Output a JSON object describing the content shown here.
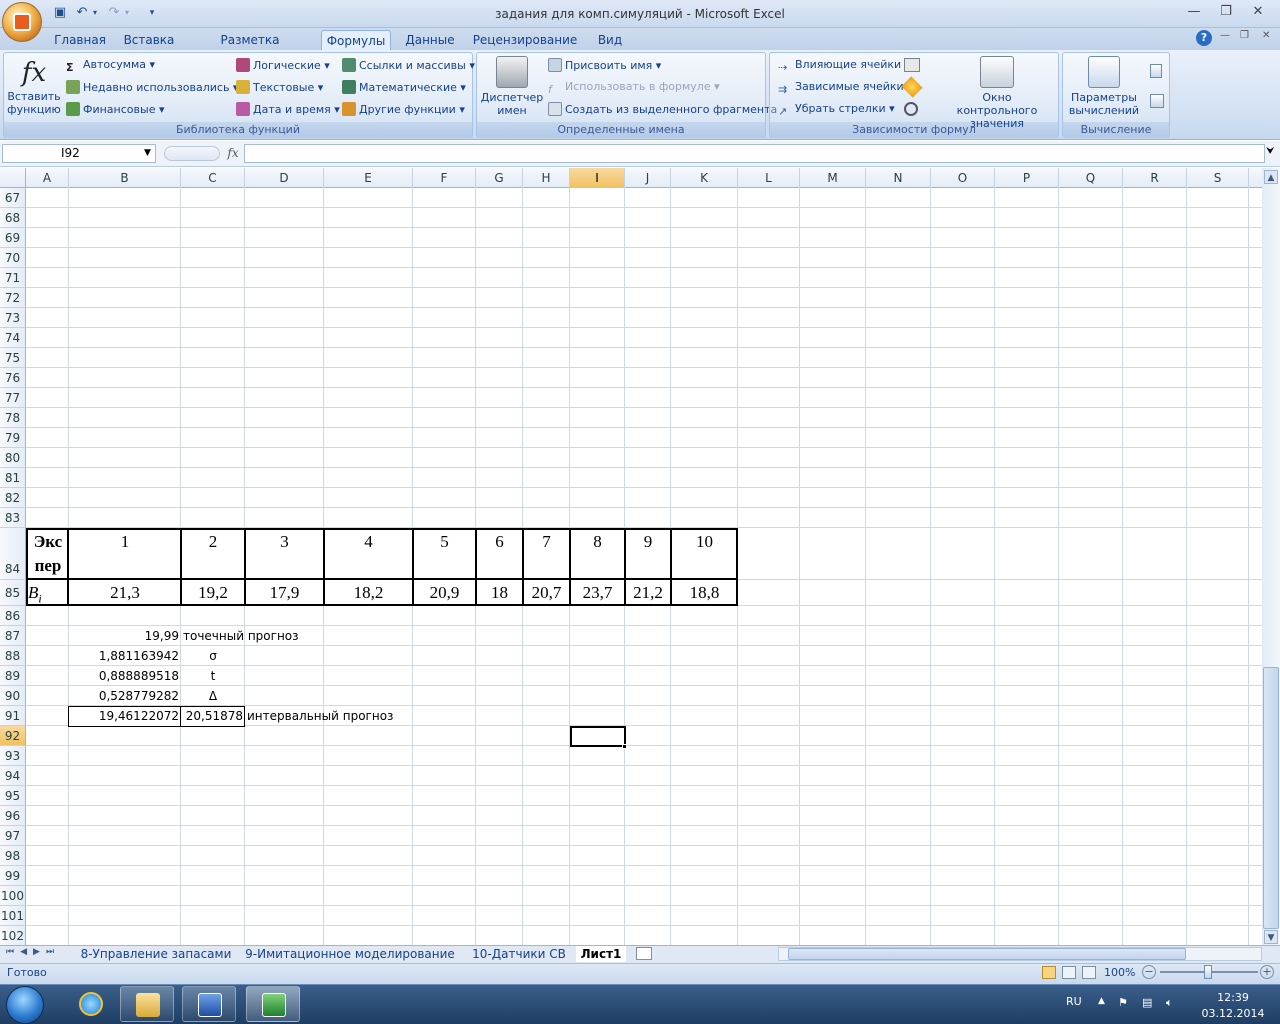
{
  "window": {
    "title": "задания для комп.симуляций - Microsoft Excel"
  },
  "tabs": [
    {
      "label": "Главная"
    },
    {
      "label": "Вставка"
    },
    {
      "label": "Разметка страницы"
    },
    {
      "label": "Формулы"
    },
    {
      "label": "Данные"
    },
    {
      "label": "Рецензирование"
    },
    {
      "label": "Вид"
    }
  ],
  "ribbon": {
    "insert_function": "Вставить функцию",
    "autosum": "Автосумма",
    "recent": "Недавно использовались",
    "financial": "Финансовые",
    "logical": "Логические",
    "text": "Текстовые",
    "datetime": "Дата и время",
    "lookup": "Ссылки и массивы",
    "math": "Математические",
    "other": "Другие функции",
    "group_library": "Библиотека функций",
    "name_manager": "Диспетчер имен",
    "define_name": "Присвоить имя",
    "use_in_formula": "Использовать в формуле",
    "create_from_sel": "Создать из выделенного фрагмента",
    "group_names": "Определенные имена",
    "trace_precedents": "Влияющие ячейки",
    "trace_dependents": "Зависимые ячейки",
    "remove_arrows": "Убрать стрелки",
    "watch_window": "Окно контрольного значения",
    "group_auditing": "Зависимости формул",
    "calc_options": "Параметры вычислений",
    "group_calc": "Вычисление"
  },
  "formula_bar": {
    "name_box": "I92",
    "fx": "fx",
    "formula": ""
  },
  "columns": [
    "A",
    "B",
    "C",
    "D",
    "E",
    "F",
    "G",
    "H",
    "I",
    "J",
    "K",
    "L",
    "M",
    "N",
    "O",
    "P",
    "Q",
    "R",
    "S"
  ],
  "rows": [
    "67",
    "68",
    "69",
    "70",
    "71",
    "72",
    "73",
    "74",
    "75",
    "76",
    "77",
    "78",
    "79",
    "80",
    "81",
    "82",
    "83",
    "84",
    "85",
    "86",
    "87",
    "88",
    "89",
    "90",
    "91",
    "92",
    "93",
    "94",
    "95",
    "96",
    "97",
    "98",
    "99",
    "100",
    "101",
    "102"
  ],
  "table": {
    "header_label": "Экс пер",
    "header_label_l1": "Экс",
    "header_label_l2": "пер",
    "row_label": "B",
    "row_label_sub": "i",
    "experiments": [
      "1",
      "2",
      "3",
      "4",
      "5",
      "6",
      "7",
      "8",
      "9",
      "10"
    ],
    "values": [
      "21,3",
      "19,2",
      "17,9",
      "18,2",
      "20,9",
      "18",
      "20,7",
      "23,7",
      "21,2",
      "18,8"
    ]
  },
  "calc": {
    "point_value": "19,99",
    "point_label": "точечный прогноз",
    "sigma_value": "1,881163942",
    "sigma_label": "σ",
    "t_value": "0,888889518",
    "t_label": "t",
    "delta_value": "0,528779282",
    "delta_label": "Δ",
    "interval_low": "19,46122072",
    "interval_high": "20,51878",
    "interval_label": "интервальный прогноз"
  },
  "sheets": [
    {
      "label": "8-Управление запасами"
    },
    {
      "label": "9-Имитационное моделирование"
    },
    {
      "label": "10-Датчики СВ"
    },
    {
      "label": "Лист1"
    }
  ],
  "status": {
    "ready": "Готово",
    "zoom": "100%"
  },
  "taskbar": {
    "lang": "RU",
    "time": "12:39",
    "date": "03.12.2014"
  }
}
